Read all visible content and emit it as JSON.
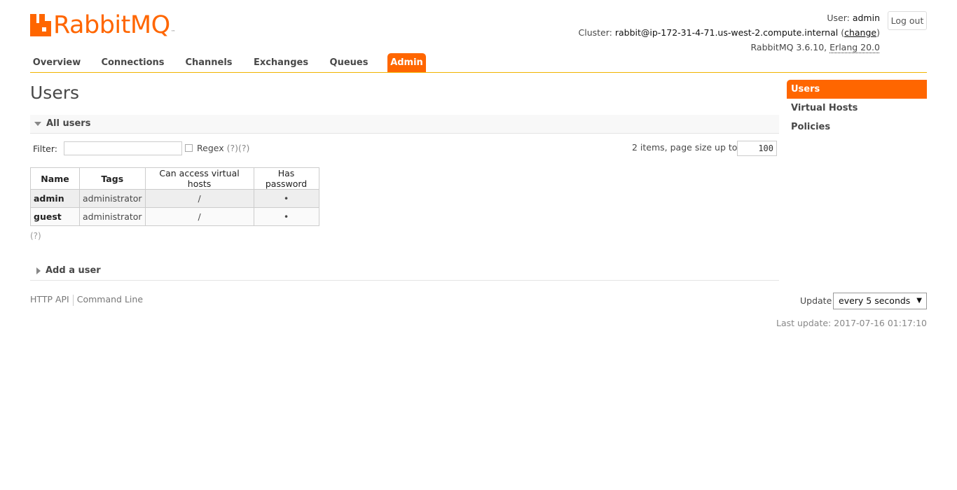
{
  "brand": {
    "name": "RabbitMQ",
    "tm": "™",
    "color": "#ff6600"
  },
  "header": {
    "user_label": "User:",
    "user": "admin",
    "cluster_label": "Cluster:",
    "cluster": "rabbit@ip-172-31-4-71.us-west-2.compute.internal",
    "change_label": "change",
    "version": "RabbitMQ 3.6.10,",
    "erlang": "Erlang 20.0",
    "logout_label": "Log out"
  },
  "tabs": [
    {
      "label": "Overview"
    },
    {
      "label": "Connections"
    },
    {
      "label": "Channels"
    },
    {
      "label": "Exchanges"
    },
    {
      "label": "Queues"
    },
    {
      "label": "Admin",
      "active": true
    }
  ],
  "page_title": "Users",
  "all_users": {
    "heading": "All users",
    "filter_label": "Filter:",
    "filter_value": "",
    "regex_label": "Regex",
    "regex_help": "(?)(?)",
    "items_info": "2 items, page size up to",
    "page_size": "100",
    "columns": [
      "Name",
      "Tags",
      "Can access virtual hosts",
      "Has password"
    ],
    "rows": [
      {
        "name": "admin",
        "tags": "administrator",
        "vhosts": "/",
        "has_password": "•"
      },
      {
        "name": "guest",
        "tags": "administrator",
        "vhosts": "/",
        "has_password": "•"
      }
    ],
    "help": "(?)"
  },
  "add_user": {
    "heading": "Add a user"
  },
  "footer": {
    "http_api": "HTTP API",
    "command_line": "Command Line",
    "update_label": "Update",
    "update_value": "every 5 seconds",
    "last_update": "Last update: 2017-07-16 01:17:10"
  },
  "sidebar": {
    "items": [
      {
        "label": "Users",
        "active": true
      },
      {
        "label": "Virtual Hosts"
      },
      {
        "label": "Policies"
      }
    ]
  }
}
